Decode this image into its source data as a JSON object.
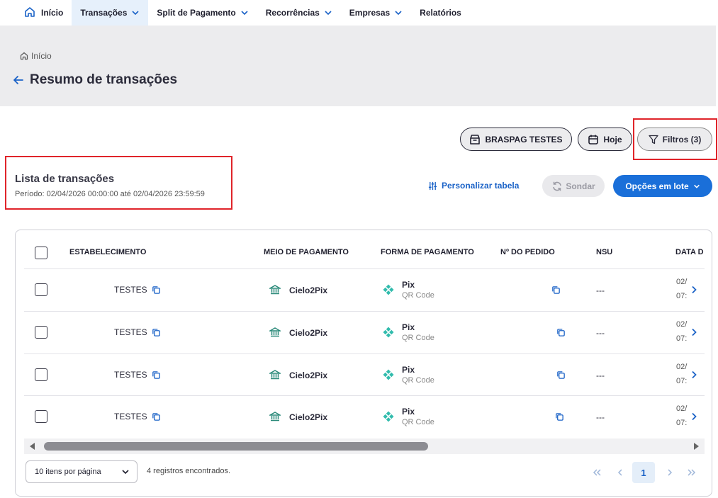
{
  "nav": {
    "home": "Início",
    "items": [
      {
        "label": "Transações",
        "dropdown": true,
        "active": true
      },
      {
        "label": "Split de Pagamento",
        "dropdown": true
      },
      {
        "label": "Recorrências",
        "dropdown": true
      },
      {
        "label": "Empresas",
        "dropdown": true
      },
      {
        "label": "Relatórios",
        "dropdown": false
      }
    ]
  },
  "header": {
    "breadcrumb": "Início",
    "title": "Resumo de transações"
  },
  "actions": {
    "merchant": "BRASPAG TESTES",
    "today": "Hoje",
    "filters": "Filtros (3)"
  },
  "list": {
    "title": "Lista de transações",
    "period": "Período: 02/04/2026 00:00:00 até 02/04/2026 23:59:59",
    "customize": "Personalizar tabela",
    "probe": "Sondar",
    "batch": "Opções em lote"
  },
  "table": {
    "columns": [
      "ESTABELECIMENTO",
      "MEIO DE PAGAMENTO",
      "FORMA DE PAGAMENTO",
      "Nº DO PEDIDO",
      "NSU",
      "DATA D"
    ],
    "rows": [
      {
        "merchant": "TESTES",
        "provider": "Cielo2Pix",
        "method": "Pix",
        "method_sub": "QR Code",
        "nsu": "---",
        "date_1": "02/",
        "date_2": "07:"
      },
      {
        "merchant": "TESTES",
        "provider": "Cielo2Pix",
        "method": "Pix",
        "method_sub": "QR Code",
        "nsu": "---",
        "date_1": "02/",
        "date_2": "07:"
      },
      {
        "merchant": "TESTES",
        "provider": "Cielo2Pix",
        "method": "Pix",
        "method_sub": "QR Code",
        "nsu": "---",
        "date_1": "02/",
        "date_2": "07:"
      },
      {
        "merchant": "TESTES",
        "provider": "Cielo2Pix",
        "method": "Pix",
        "method_sub": "QR Code",
        "nsu": "---",
        "date_1": "02/",
        "date_2": "07:"
      }
    ]
  },
  "footer": {
    "per_page": "10 itens por página",
    "found": "4 registros encontrados.",
    "current_page": "1"
  },
  "colors": {
    "accent": "#1a6fd9",
    "nav_active_bg": "#e6f0fb",
    "highlight_box": "#e0242a",
    "pix": "#32bcad"
  }
}
